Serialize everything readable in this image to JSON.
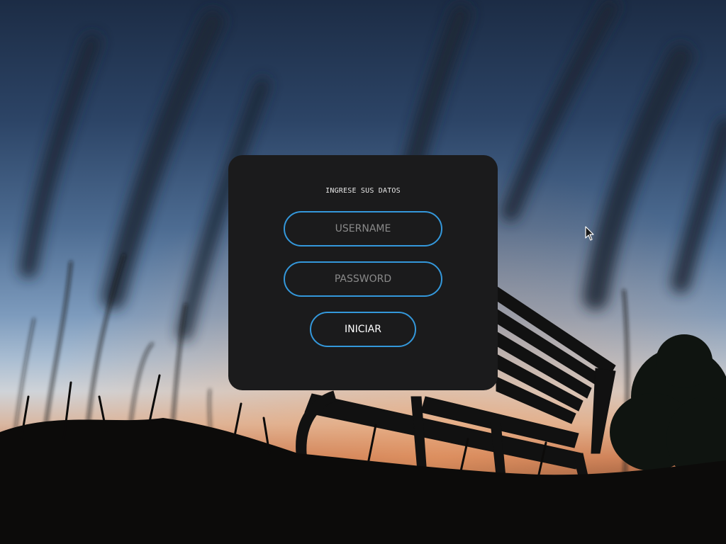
{
  "login": {
    "title": "INGRESE SUS DATOS",
    "username_placeholder": "USERNAME",
    "username_value": "",
    "password_placeholder": "PASSWORD",
    "password_value": "",
    "submit_label": "INICIAR"
  },
  "colors": {
    "accent": "#3498db",
    "card_background": "#1b1b1c",
    "title_text": "#e8e8e8",
    "placeholder_text": "#8a8a8a",
    "button_text": "#ffffff"
  },
  "icons": {
    "cursor": "mouse-pointer-icon"
  }
}
